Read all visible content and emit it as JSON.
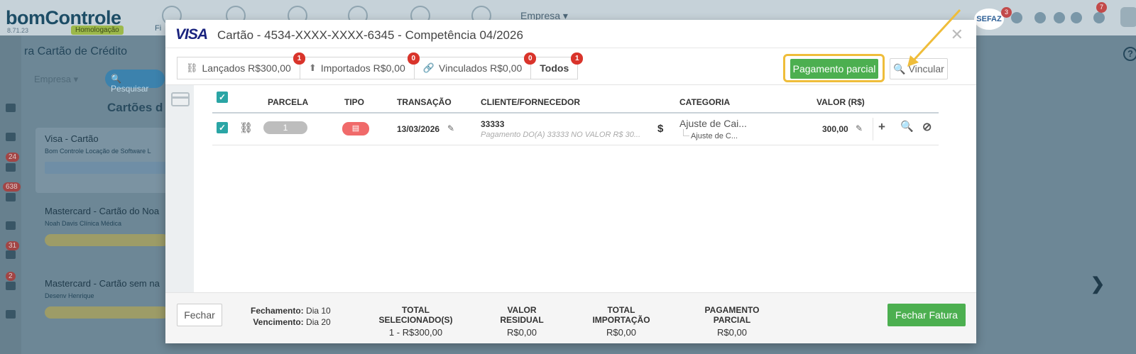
{
  "background": {
    "logo_part1": "bom",
    "logo_part2": "Controle",
    "env_badge": "Homologação",
    "version": "8.71.23",
    "fin_label": "Fi",
    "empresa_top": "Empresa ▾",
    "sefaz": "SEFAZ",
    "sefaz_badge": "3",
    "bell_badge": "7",
    "page_title": "ra Cartão de Crédito",
    "empresa_filter": "Empresa ▾",
    "search_button": "Pesquisar",
    "cards_heading": "Cartões d",
    "side_badges": [
      "24",
      "638",
      "31",
      "2"
    ],
    "cards": [
      {
        "title": "Visa - Cartão",
        "subtitle": "Bom Controle Locação de Software L"
      },
      {
        "title": "Mastercard - Cartão do Noa",
        "subtitle": "Noah Davis Clínica Médica"
      },
      {
        "title": "Mastercard - Cartão sem na",
        "subtitle": "Desenv Henrique"
      }
    ]
  },
  "modal": {
    "brand": "VISA",
    "title": "Cartão - 4534-XXXX-XXXX-6345 - Competência 04/2026",
    "close": "✕",
    "tabs": [
      {
        "label": "Lançados R$300,00",
        "badge": "1",
        "icon": "unlink-icon"
      },
      {
        "label": "Importados R$0,00",
        "badge": "0",
        "icon": "upload-icon"
      },
      {
        "label": "Vinculados R$0,00",
        "badge": "0",
        "icon": "link-icon"
      },
      {
        "label": "Todos",
        "badge": "1"
      }
    ],
    "partial_payment_button": "Pagamento parcial",
    "link_button": "Vincular",
    "columns": {
      "parcela": "PARCELA",
      "tipo": "TIPO",
      "transacao": "TRANSAÇÃO",
      "cliente": "CLIENTE/FORNECEDOR",
      "categoria": "CATEGORIA",
      "valor": "VALOR (R$)"
    },
    "rows": [
      {
        "parcela": "1",
        "date": "13/03/2026",
        "client": "33333",
        "description": "Pagamento DO(A) 33333 NO VALOR R$ 30...",
        "category": "Ajuste de Cai...",
        "subcategory": "Ajuste de C...",
        "value": "300,00"
      }
    ],
    "footer": {
      "close_button": "Fechar",
      "fechamento_label": "Fechamento:",
      "fechamento_value": "Dia 10",
      "vencimento_label": "Vencimento:",
      "vencimento_value": "Dia 20",
      "total_sel_label": "TOTAL SELECIONADO(S)",
      "total_sel_value": "1 - R$300,00",
      "residual_label": "VALOR RESIDUAL",
      "residual_value": "R$0,00",
      "import_label": "TOTAL IMPORTAÇÃO",
      "import_value": "R$0,00",
      "partial_label": "PAGAMENTO PARCIAL",
      "partial_value": "R$0,00",
      "close_invoice_button": "Fechar Fatura"
    }
  },
  "colors": {
    "primary_green": "#4caf50",
    "highlight": "#efbd3a",
    "badge_red": "#d9342b",
    "checkbox_teal": "#2aa5a5"
  }
}
